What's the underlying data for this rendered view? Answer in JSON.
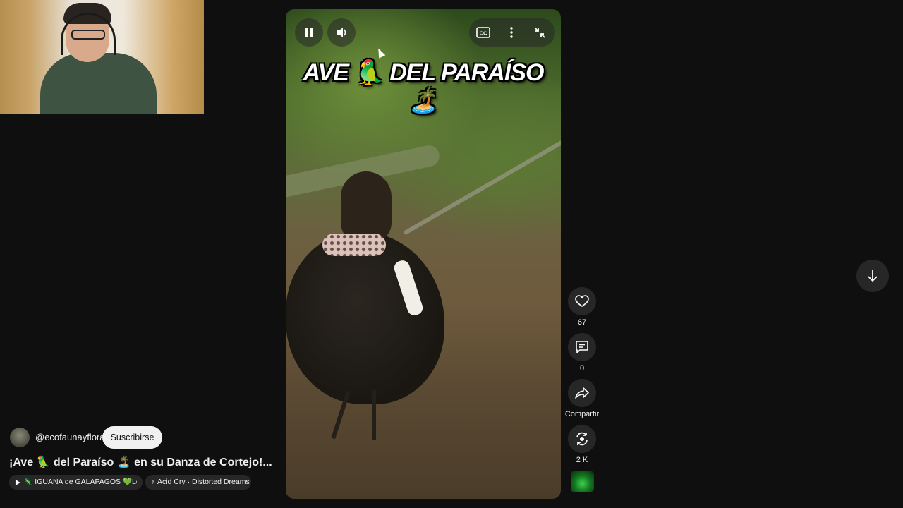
{
  "video": {
    "overlay_title": "AVE 🦜 DEL PARAÍSO 🏝️",
    "controls": {
      "pause_icon": "pause-icon",
      "volume_icon": "volume-icon",
      "captions_label": "CC",
      "more_icon": "more-vert-icon",
      "minimize_icon": "exit-fullscreen-icon"
    }
  },
  "actions": {
    "like_count": "67",
    "comment_count": "0",
    "share_label": "Compartir",
    "remix_count": "2 K"
  },
  "channel": {
    "handle": "@ecofaunayflora",
    "subscribe_label": "Suscribirse"
  },
  "short": {
    "title": "¡Ave 🦜 del Paraíso 🏝️ en su Danza de Cortejo!..."
  },
  "chips": {
    "related": "🦎 IGUANA de GALÁPAGOS 💚Lo...",
    "sound": "Acid Cry · Distorted Dreams"
  },
  "colors": {
    "background": "#0f0f0f",
    "button_bg": "#272727",
    "subscribe_bg": "#f1f1f1"
  }
}
